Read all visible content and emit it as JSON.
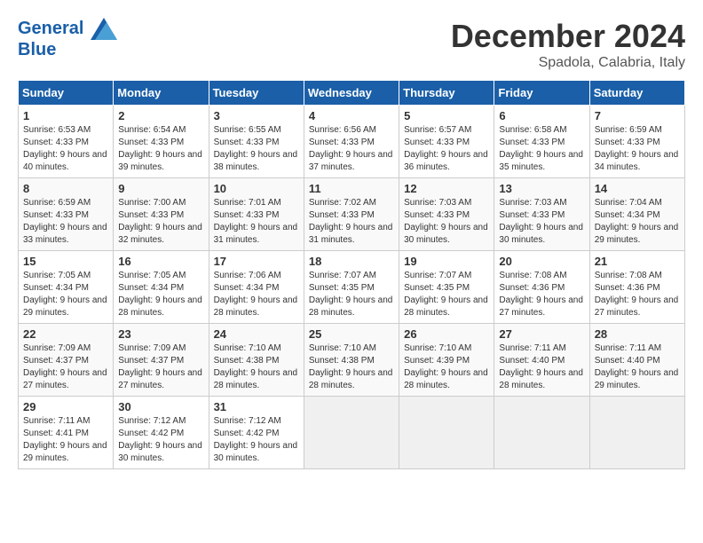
{
  "logo": {
    "line1": "General",
    "line2": "Blue"
  },
  "title": "December 2024",
  "subtitle": "Spadola, Calabria, Italy",
  "days_of_week": [
    "Sunday",
    "Monday",
    "Tuesday",
    "Wednesday",
    "Thursday",
    "Friday",
    "Saturday"
  ],
  "weeks": [
    [
      {
        "day": 1,
        "sunrise": "6:53 AM",
        "sunset": "4:33 PM",
        "daylight": "9 hours and 40 minutes."
      },
      {
        "day": 2,
        "sunrise": "6:54 AM",
        "sunset": "4:33 PM",
        "daylight": "9 hours and 39 minutes."
      },
      {
        "day": 3,
        "sunrise": "6:55 AM",
        "sunset": "4:33 PM",
        "daylight": "9 hours and 38 minutes."
      },
      {
        "day": 4,
        "sunrise": "6:56 AM",
        "sunset": "4:33 PM",
        "daylight": "9 hours and 37 minutes."
      },
      {
        "day": 5,
        "sunrise": "6:57 AM",
        "sunset": "4:33 PM",
        "daylight": "9 hours and 36 minutes."
      },
      {
        "day": 6,
        "sunrise": "6:58 AM",
        "sunset": "4:33 PM",
        "daylight": "9 hours and 35 minutes."
      },
      {
        "day": 7,
        "sunrise": "6:59 AM",
        "sunset": "4:33 PM",
        "daylight": "9 hours and 34 minutes."
      }
    ],
    [
      {
        "day": 8,
        "sunrise": "6:59 AM",
        "sunset": "4:33 PM",
        "daylight": "9 hours and 33 minutes."
      },
      {
        "day": 9,
        "sunrise": "7:00 AM",
        "sunset": "4:33 PM",
        "daylight": "9 hours and 32 minutes."
      },
      {
        "day": 10,
        "sunrise": "7:01 AM",
        "sunset": "4:33 PM",
        "daylight": "9 hours and 31 minutes."
      },
      {
        "day": 11,
        "sunrise": "7:02 AM",
        "sunset": "4:33 PM",
        "daylight": "9 hours and 31 minutes."
      },
      {
        "day": 12,
        "sunrise": "7:03 AM",
        "sunset": "4:33 PM",
        "daylight": "9 hours and 30 minutes."
      },
      {
        "day": 13,
        "sunrise": "7:03 AM",
        "sunset": "4:33 PM",
        "daylight": "9 hours and 30 minutes."
      },
      {
        "day": 14,
        "sunrise": "7:04 AM",
        "sunset": "4:34 PM",
        "daylight": "9 hours and 29 minutes."
      }
    ],
    [
      {
        "day": 15,
        "sunrise": "7:05 AM",
        "sunset": "4:34 PM",
        "daylight": "9 hours and 29 minutes."
      },
      {
        "day": 16,
        "sunrise": "7:05 AM",
        "sunset": "4:34 PM",
        "daylight": "9 hours and 28 minutes."
      },
      {
        "day": 17,
        "sunrise": "7:06 AM",
        "sunset": "4:34 PM",
        "daylight": "9 hours and 28 minutes."
      },
      {
        "day": 18,
        "sunrise": "7:07 AM",
        "sunset": "4:35 PM",
        "daylight": "9 hours and 28 minutes."
      },
      {
        "day": 19,
        "sunrise": "7:07 AM",
        "sunset": "4:35 PM",
        "daylight": "9 hours and 28 minutes."
      },
      {
        "day": 20,
        "sunrise": "7:08 AM",
        "sunset": "4:36 PM",
        "daylight": "9 hours and 27 minutes."
      },
      {
        "day": 21,
        "sunrise": "7:08 AM",
        "sunset": "4:36 PM",
        "daylight": "9 hours and 27 minutes."
      }
    ],
    [
      {
        "day": 22,
        "sunrise": "7:09 AM",
        "sunset": "4:37 PM",
        "daylight": "9 hours and 27 minutes."
      },
      {
        "day": 23,
        "sunrise": "7:09 AM",
        "sunset": "4:37 PM",
        "daylight": "9 hours and 27 minutes."
      },
      {
        "day": 24,
        "sunrise": "7:10 AM",
        "sunset": "4:38 PM",
        "daylight": "9 hours and 28 minutes."
      },
      {
        "day": 25,
        "sunrise": "7:10 AM",
        "sunset": "4:38 PM",
        "daylight": "9 hours and 28 minutes."
      },
      {
        "day": 26,
        "sunrise": "7:10 AM",
        "sunset": "4:39 PM",
        "daylight": "9 hours and 28 minutes."
      },
      {
        "day": 27,
        "sunrise": "7:11 AM",
        "sunset": "4:40 PM",
        "daylight": "9 hours and 28 minutes."
      },
      {
        "day": 28,
        "sunrise": "7:11 AM",
        "sunset": "4:40 PM",
        "daylight": "9 hours and 29 minutes."
      }
    ],
    [
      {
        "day": 29,
        "sunrise": "7:11 AM",
        "sunset": "4:41 PM",
        "daylight": "9 hours and 29 minutes."
      },
      {
        "day": 30,
        "sunrise": "7:12 AM",
        "sunset": "4:42 PM",
        "daylight": "9 hours and 30 minutes."
      },
      {
        "day": 31,
        "sunrise": "7:12 AM",
        "sunset": "4:42 PM",
        "daylight": "9 hours and 30 minutes."
      },
      null,
      null,
      null,
      null
    ]
  ]
}
